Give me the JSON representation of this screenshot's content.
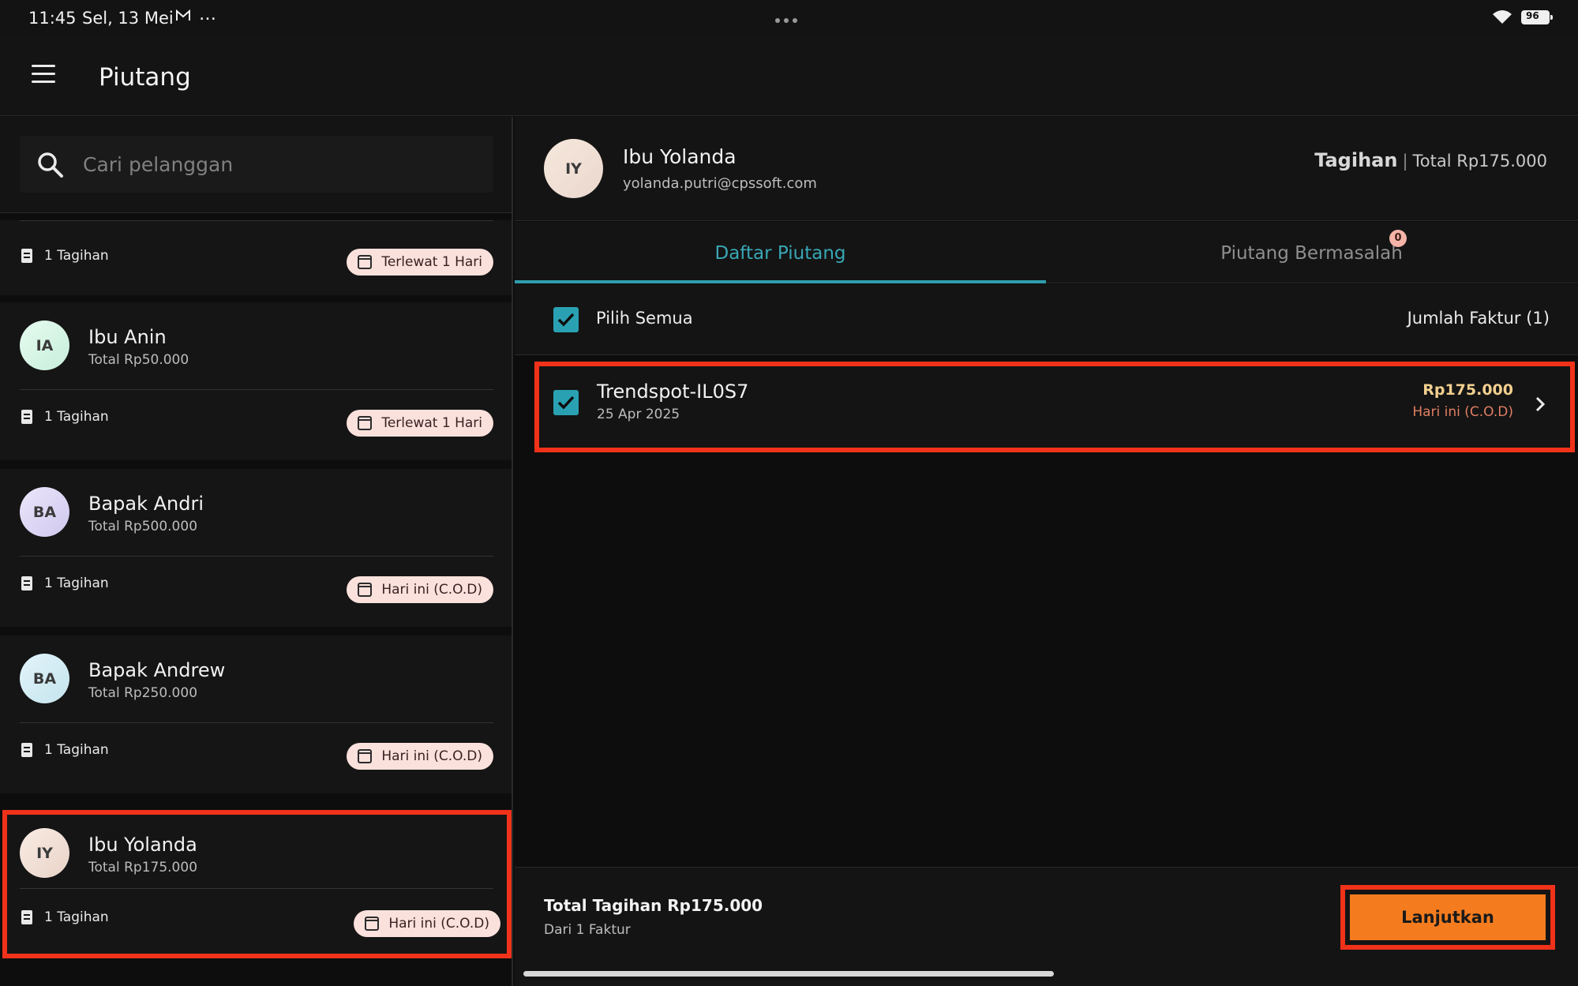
{
  "status_bar": {
    "time": "11:45",
    "date": "Sel, 13 Mei",
    "mail_icon": "mail-icon",
    "more_icon": "…",
    "battery": "96"
  },
  "app_bar": {
    "title": "Piutang"
  },
  "search": {
    "placeholder": "Cari pelanggan",
    "value": ""
  },
  "customers": [
    {
      "initials": "",
      "name": "",
      "total": "",
      "invoices": "1 Tagihan",
      "status": "Terlewat 1 Hari",
      "avatar_gradient": "#2a2a2a"
    },
    {
      "initials": "IA",
      "name": "Ibu Anin",
      "total": "Total Rp50.000",
      "invoices": "1 Tagihan",
      "status": "Terlewat 1 Hari",
      "avatar_gradient": "#d8f6e6"
    },
    {
      "initials": "BA",
      "name": "Bapak Andri",
      "total": "Total Rp500.000",
      "invoices": "1 Tagihan",
      "status": "Hari ini (C.O.D)",
      "avatar_gradient": "#dcd7f2"
    },
    {
      "initials": "BA",
      "name": "Bapak Andrew",
      "total": "Total Rp250.000",
      "invoices": "1 Tagihan",
      "status": "Hari ini (C.O.D)",
      "avatar_gradient": "#d5ecf2"
    },
    {
      "initials": "IY",
      "name": "Ibu Yolanda",
      "total": "Total Rp175.000",
      "invoices": "1 Tagihan",
      "status": "Hari ini (C.O.D)",
      "avatar_gradient": "#f4e4da"
    }
  ],
  "detail": {
    "initials": "IY",
    "name": "Ibu Yolanda",
    "email": "yolanda.putri@cpssoft.com",
    "tagihan_label": "Tagihan",
    "tagihan_total": "Total Rp175.000"
  },
  "tabs": [
    {
      "label": "Daftar Piutang",
      "active": true
    },
    {
      "label": "Piutang Bermasalah",
      "active": false,
      "badge": "0"
    }
  ],
  "select_all": {
    "label": "Pilih Semua",
    "count": "Jumlah Faktur (1)",
    "checked": true
  },
  "invoices": [
    {
      "name": "Trendspot-IL0S7",
      "date": "25 Apr 2025",
      "amount": "Rp175.000",
      "status": "Hari ini (C.O.D)",
      "checked": true
    }
  ],
  "footer": {
    "total": "Total Tagihan Rp175.000",
    "sub": "Dari 1 Faktur",
    "button": "Lanjutkan"
  },
  "colors": {
    "accent_teal": "#2aa1b3",
    "primary_orange": "#f47c1f",
    "highlight_red": "#f0321a",
    "badge_pink": "#fbe1dc",
    "amount_gold": "#f2cf8f",
    "status_orange": "#e07e63"
  }
}
